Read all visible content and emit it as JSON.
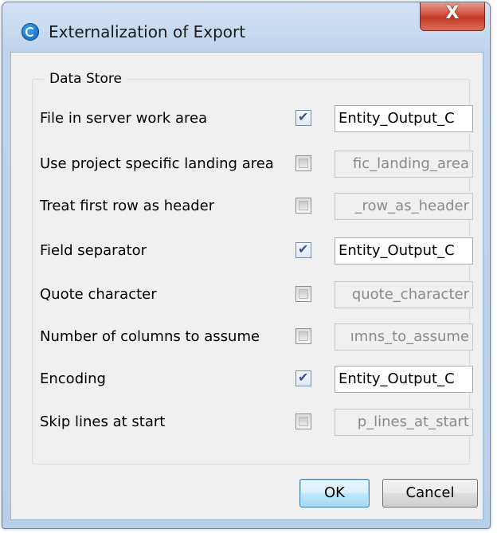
{
  "window": {
    "title": "Externalization of Export",
    "close_glyph": "X"
  },
  "group": {
    "label": "Data Store"
  },
  "rows": [
    {
      "label": "File in server work area",
      "checked": true,
      "value": "Entity_Output_C",
      "enabled": true
    },
    {
      "label": "Use project specific landing area",
      "checked": false,
      "value": "fic_landing_area",
      "enabled": false
    },
    {
      "label": "Treat first row as header",
      "checked": false,
      "value": "_row_as_header",
      "enabled": false
    },
    {
      "label": "Field separator",
      "checked": true,
      "value": "Entity_Output_C",
      "enabled": true
    },
    {
      "label": "Quote character",
      "checked": false,
      "value": "quote_character",
      "enabled": false
    },
    {
      "label": "Number of columns to assume",
      "checked": false,
      "value": "ımns_to_assume",
      "enabled": false
    },
    {
      "label": "Encoding",
      "checked": true,
      "value": "Entity_Output_C",
      "enabled": true
    },
    {
      "label": "Skip lines at start",
      "checked": false,
      "value": "p_lines_at_start",
      "enabled": false
    }
  ],
  "buttons": {
    "ok_label": "OK",
    "cancel_label": "Cancel"
  },
  "icons": {
    "app": "app-logo-icon",
    "close": "close-icon"
  }
}
